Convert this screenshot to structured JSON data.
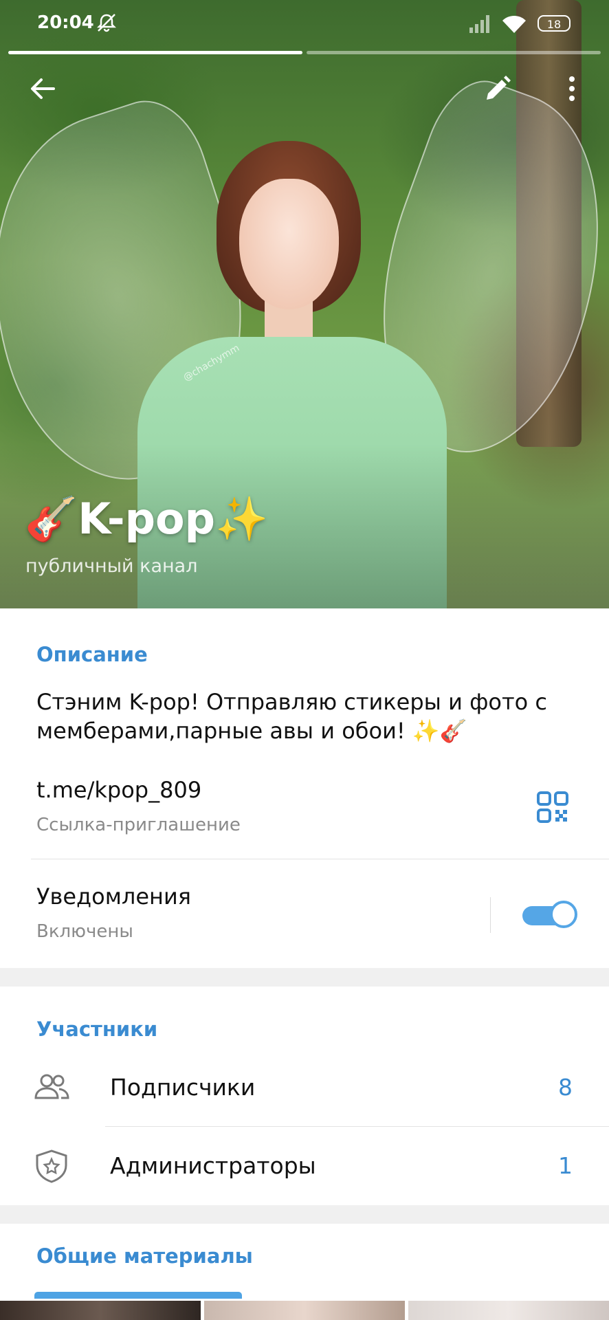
{
  "status_bar": {
    "time": "20:04",
    "battery": "18"
  },
  "channel": {
    "emoji_prefix": "🎸",
    "name": "K-pop",
    "emoji_suffix": "✨",
    "type": "публичный канал",
    "watermark": "@chachymm"
  },
  "info": {
    "description_header": "Описание",
    "description": "Стэним K-pop! Отправляю стикеры и фото с мемберами,парные авы и обои!   ✨🎸",
    "link": "t.me/kpop_809",
    "link_label": "Ссылка-приглашение",
    "notifications_label": "Уведомления",
    "notifications_status": "Включены",
    "notifications_on": true
  },
  "members": {
    "header": "Участники",
    "rows": [
      {
        "label": "Подписчики",
        "count": "8",
        "icon": "people-icon"
      },
      {
        "label": "Администраторы",
        "count": "1",
        "icon": "admin-shield-icon"
      }
    ]
  },
  "media": {
    "header": "Общие материалы"
  },
  "colors": {
    "accent": "#3a8bd1",
    "toggle": "#55a6e6"
  }
}
